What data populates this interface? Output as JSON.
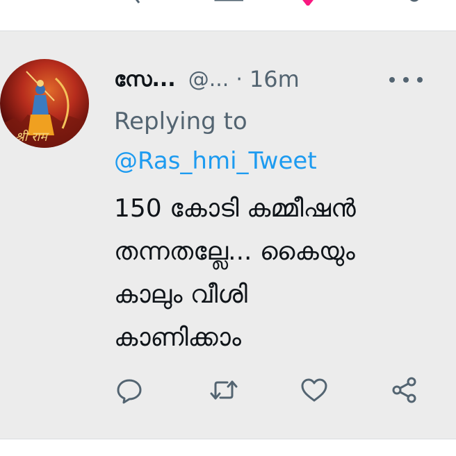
{
  "tweet": {
    "display_name": "സേ...",
    "handle": "@...",
    "separator": "·",
    "time": "16m",
    "replying_to_label": "Replying to",
    "replying_to_handle": "@Ras_hmi_Tweet",
    "text_lines": [
      "150 കോടി കമ്മീഷൻ",
      "തന്നതല്ലേ... കൈയും",
      "കാലും വീശി",
      "കാണിക്കാം"
    ]
  },
  "icons": {
    "more": "more-horizontal-icon",
    "reply": "reply-icon",
    "retweet": "retweet-icon",
    "like": "heart-icon",
    "share": "share-icon"
  },
  "colors": {
    "background": "#ececec",
    "text": "#0f1419",
    "muted": "#536471",
    "accent": "#1d9bf0"
  }
}
